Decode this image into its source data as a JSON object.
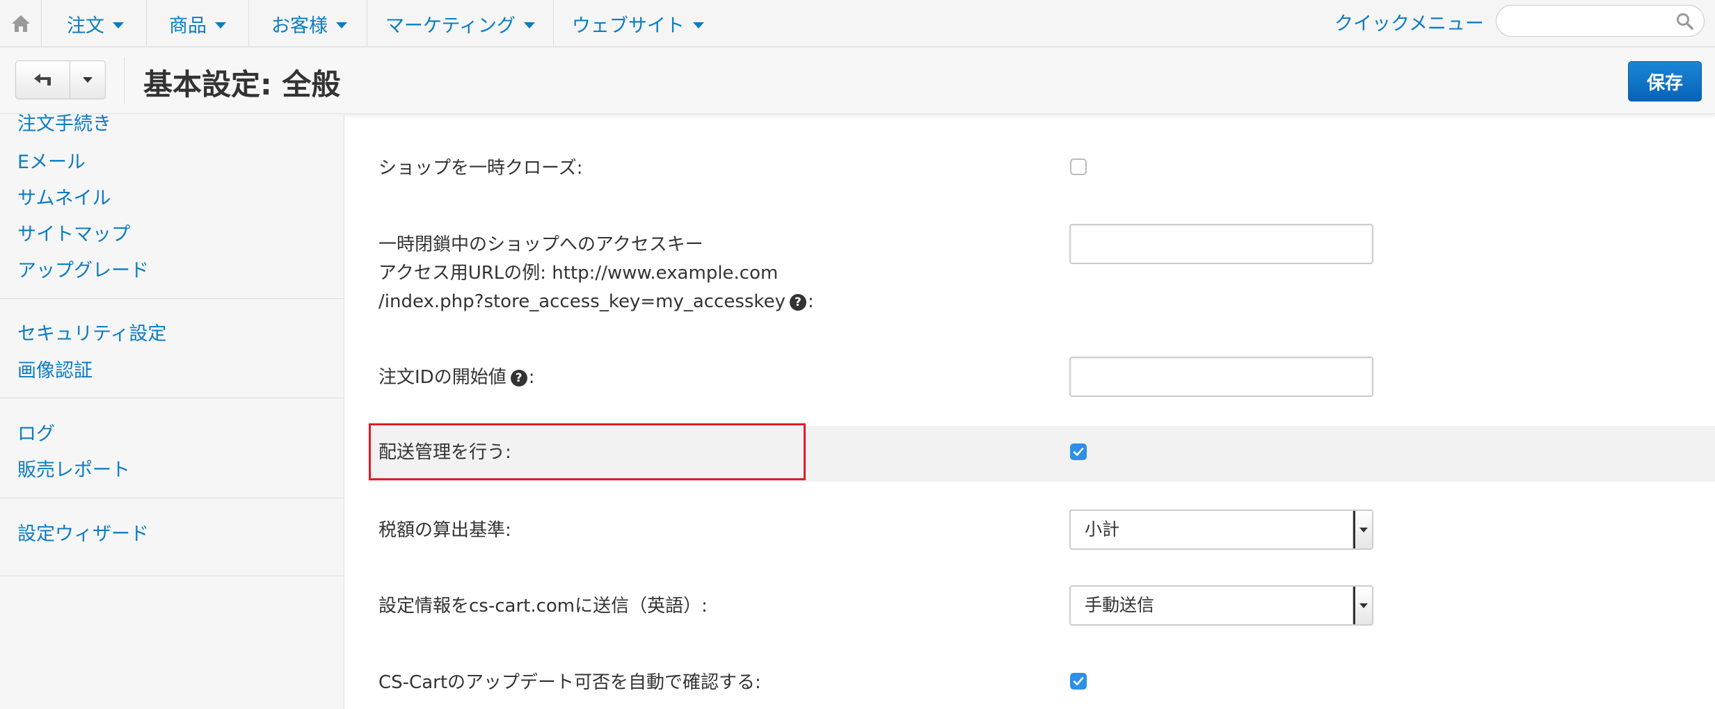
{
  "topnav": {
    "items": [
      {
        "label": "注文"
      },
      {
        "label": "商品"
      },
      {
        "label": "お客様"
      },
      {
        "label": "マーケティング"
      },
      {
        "label": "ウェブサイト"
      }
    ],
    "quick_menu": "クイックメニュー",
    "search_placeholder": ""
  },
  "header": {
    "title": "基本設定: 全般",
    "save_label": "保存"
  },
  "sidebar": {
    "items": [
      {
        "label": "注文手続き"
      },
      {
        "label": "Eメール"
      },
      {
        "label": "サムネイル"
      },
      {
        "label": "サイトマップ"
      },
      {
        "label": "アップグレード"
      },
      {
        "label": "セキュリティ設定"
      },
      {
        "label": "画像認証"
      },
      {
        "label": "ログ"
      },
      {
        "label": "販売レポート"
      },
      {
        "label": "設定ウィザード"
      }
    ]
  },
  "settings": {
    "close_shop": {
      "label": "ショップを一時クローズ:",
      "checked": false
    },
    "access_key": {
      "line1": "一時閉鎖中のショップへのアクセスキー",
      "line2": "アクセス用URLの例: http://www.example.com",
      "line3": "/index.php?store_access_key=my_accesskey",
      "suffix": ":",
      "value": ""
    },
    "order_id_start": {
      "label": "注文IDの開始値",
      "suffix": ":",
      "value": ""
    },
    "shipping": {
      "label": "配送管理を行う:",
      "checked": true
    },
    "tax_basis": {
      "label": "税額の算出基準:",
      "value": "小計"
    },
    "send_config": {
      "label": "設定情報をcs-cart.comに送信（英語）:",
      "value": "手動送信"
    },
    "auto_update": {
      "label": "CS-Cartのアップデート可否を自動で確認する:",
      "checked": true
    }
  },
  "colors": {
    "link": "#0b7cc2",
    "save_button": "#0762b8",
    "highlight_border": "#e21b23",
    "checkbox_checked": "#2d8fe6"
  }
}
